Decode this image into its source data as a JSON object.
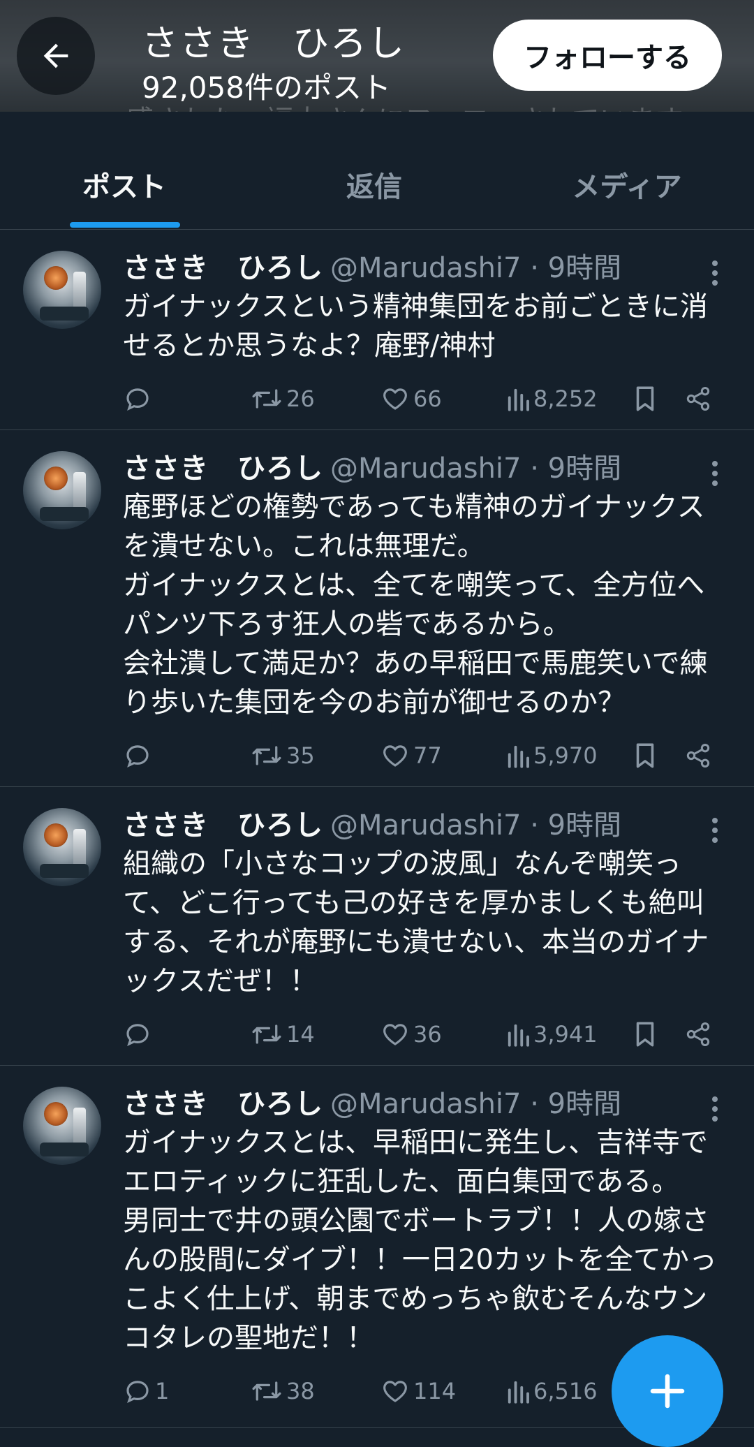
{
  "header": {
    "name": "ささき　ひろし",
    "post_count": "92,058件のポスト",
    "follow_label": "フォローする",
    "bio_partial": "感された、福大さんにフォローされています"
  },
  "tabs": [
    {
      "label": "ポスト",
      "active": true
    },
    {
      "label": "返信",
      "active": false
    },
    {
      "label": "メディア",
      "active": false
    }
  ],
  "tweets": [
    {
      "name": "ささき　ひろし",
      "meta": "@Marudashi7 · 9時間",
      "lines": [
        "ガイナックスという精神集団をお前ごときに消",
        "せるとか思うなよ？庵野/神村"
      ],
      "replies": "",
      "retweets": "26",
      "likes": "66",
      "views": "8,252"
    },
    {
      "name": "ささき　ひろし",
      "meta": "@Marudashi7 · 9時間",
      "lines": [
        "庵野ほどの権勢であっても精神のガイナックス",
        "を潰せない。これは無理だ。",
        "ガイナックスとは、全てを嘲笑って、全方位へ",
        "パンツ下ろす狂人の砦であるから。",
        "会社潰して満足か？あの早稲田で馬鹿笑いで練",
        "り歩いた集団を今のお前が御せるのか？"
      ],
      "replies": "",
      "retweets": "35",
      "likes": "77",
      "views": "5,970"
    },
    {
      "name": "ささき　ひろし",
      "meta": "@Marudashi7 · 9時間",
      "lines": [
        "組織の「小さなコップの波風」なんぞ嘲笑っ",
        "て、どこ行っても己の好きを厚かましくも絶叫",
        "する、それが庵野にも潰せない、本当のガイナ",
        "ックスだぜ！！"
      ],
      "replies": "",
      "retweets": "14",
      "likes": "36",
      "views": "3,941"
    },
    {
      "name": "ささき　ひろし",
      "meta": "@Marudashi7 · 9時間",
      "lines": [
        "ガイナックスとは、早稲田に発生し、吉祥寺で",
        "エロティックに狂乱した、面白集団である。",
        "男同士で井の頭公園でボートラブ！！人の嫁さ",
        "んの股間にダイブ！！一日20カットを全てかっ",
        "こよく仕上げ、朝までめっちゃ飲むそんなウン",
        "コタレの聖地だ！！"
      ],
      "replies": "1",
      "retweets": "38",
      "likes": "114",
      "views": "6,516"
    }
  ]
}
